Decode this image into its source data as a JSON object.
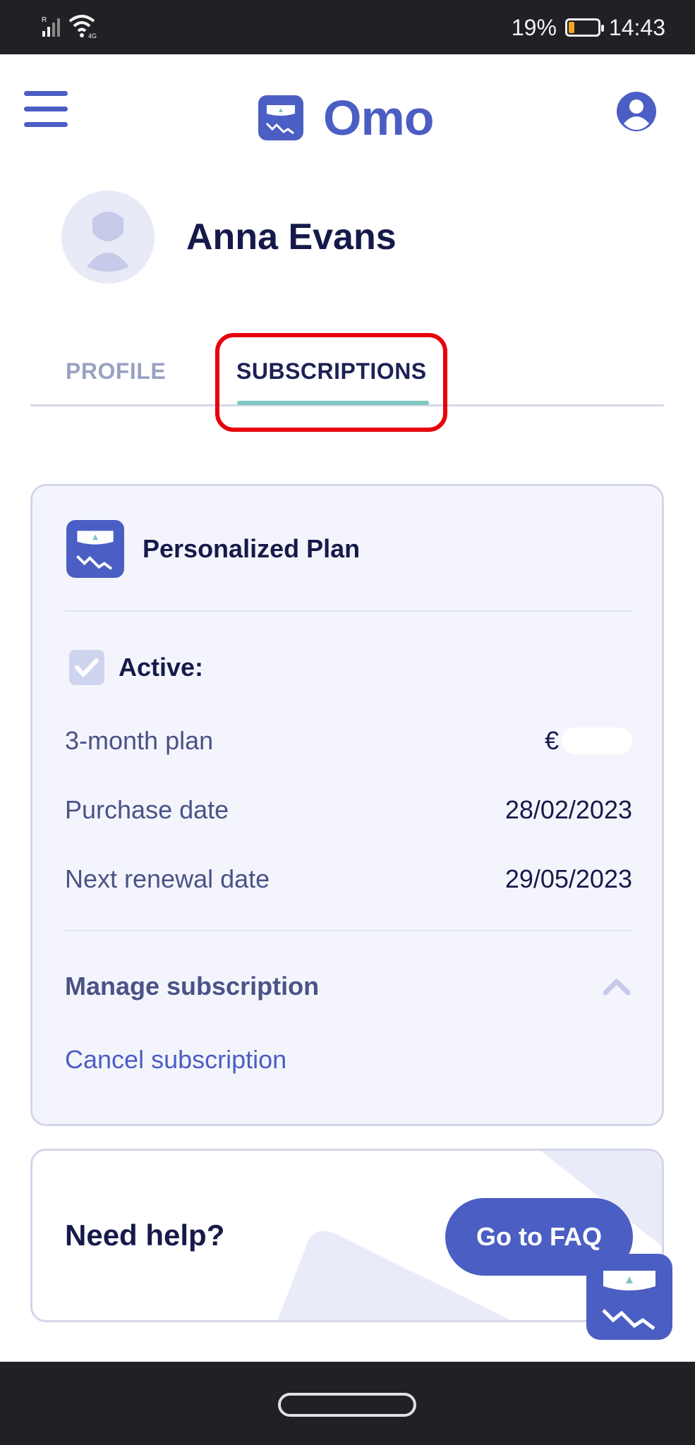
{
  "status_bar": {
    "signal_label": "R",
    "wifi_label": "4G",
    "battery_text": "19%",
    "battery_level": 0.19,
    "time": "14:43",
    "icons": [
      "signal-icon",
      "wifi-icon",
      "battery-icon"
    ]
  },
  "app_bar": {
    "brand": "Omo",
    "icons": [
      "menu-icon",
      "scale-logo-icon",
      "account-icon"
    ]
  },
  "user": {
    "name": "Anna Evans"
  },
  "tabs": [
    {
      "label": "PROFILE",
      "selected": false
    },
    {
      "label": "SUBSCRIPTIONS",
      "selected": true
    }
  ],
  "subscription": {
    "title": "Personalized Plan",
    "status_label": "Active:",
    "rows": [
      {
        "label": "3-month plan",
        "value": "€"
      },
      {
        "label": "Purchase date",
        "value": "28/02/2023"
      },
      {
        "label": "Next renewal date",
        "value": "29/05/2023"
      }
    ],
    "manage_label": "Manage subscription",
    "cancel_label": "Cancel subscription"
  },
  "help": {
    "title": "Need help?",
    "button_label": "Go to FAQ"
  },
  "colors": {
    "brand": "#4b5ec4",
    "tab_underline": "#7fc6c0",
    "highlight": "#e8000b",
    "card_bg": "#f4f5fc"
  }
}
